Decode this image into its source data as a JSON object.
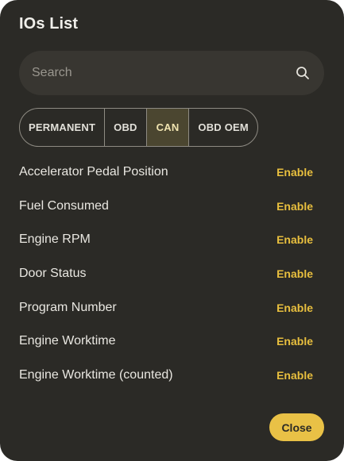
{
  "dialog": {
    "title": "IOs List"
  },
  "search": {
    "placeholder": "Search",
    "value": "",
    "icon": "search-icon"
  },
  "tabs": [
    {
      "label": "PERMANENT",
      "active": false
    },
    {
      "label": "OBD",
      "active": false
    },
    {
      "label": "CAN",
      "active": true
    },
    {
      "label": "OBD OEM",
      "active": false
    }
  ],
  "io_items": [
    {
      "name": "Accelerator Pedal Position",
      "action": "Enable"
    },
    {
      "name": "Fuel Consumed",
      "action": "Enable"
    },
    {
      "name": "Engine RPM",
      "action": "Enable"
    },
    {
      "name": "Door Status",
      "action": "Enable"
    },
    {
      "name": "Program Number",
      "action": "Enable"
    },
    {
      "name": "Engine Worktime",
      "action": "Enable"
    },
    {
      "name": "Engine Worktime (counted)",
      "action": "Enable"
    }
  ],
  "footer": {
    "close_label": "Close"
  },
  "colors": {
    "dialog_bg": "#2b2a26",
    "accent": "#e9c146",
    "active_tab_bg": "#4b4630"
  }
}
